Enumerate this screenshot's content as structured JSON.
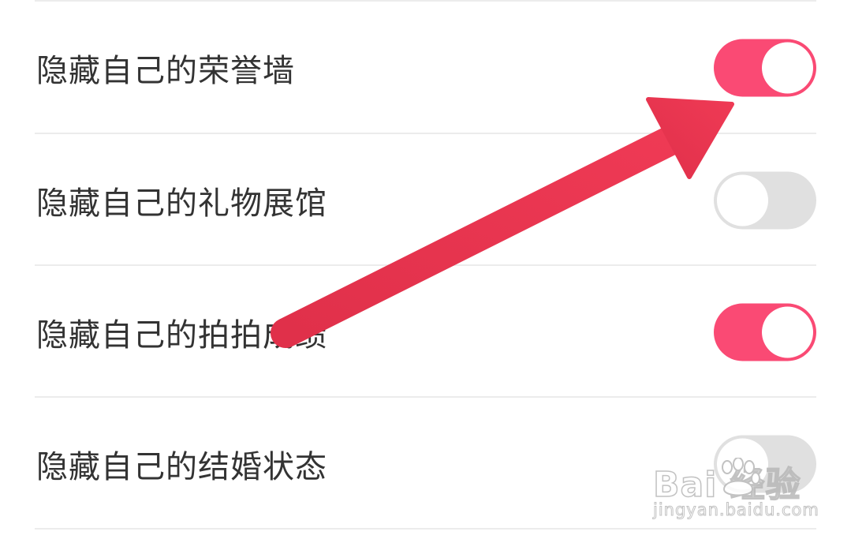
{
  "settings": [
    {
      "label": "隐藏自己的荣誉墙",
      "enabled": true
    },
    {
      "label": "隐藏自己的礼物展馆",
      "enabled": false
    },
    {
      "label": "隐藏自己的拍拍成绩",
      "enabled": true
    },
    {
      "label": "隐藏自己的结婚状态",
      "enabled": false
    }
  ],
  "colors": {
    "toggle_on": "#fa4a74",
    "toggle_off": "#e0e0e0",
    "annotation_arrow": "#e8344d"
  },
  "watermark": {
    "logo": "Bai 经验",
    "site": "jingyan.baidu.com"
  }
}
